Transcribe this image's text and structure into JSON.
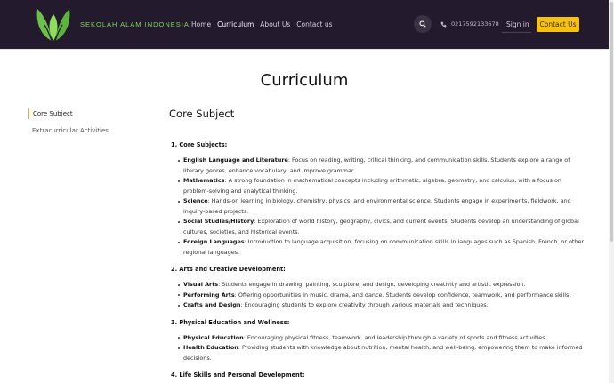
{
  "header": {
    "brand": "SEKOLAH ALAM INDONESIA",
    "nav": [
      {
        "label": "Home",
        "active": false
      },
      {
        "label": "Curriculum",
        "active": true
      },
      {
        "label": "About Us",
        "active": false
      },
      {
        "label": "Contact us",
        "active": false
      }
    ],
    "phone": "0217592133678",
    "signin": "Sign in",
    "contact_button": "Contact Us",
    "colors": {
      "background": "#241a2e",
      "accent": "#f5c211",
      "logo": "#7ed957"
    }
  },
  "page_title": "Curriculum",
  "sidebar": {
    "items": [
      {
        "label": "Core Subject",
        "active": true
      },
      {
        "label": "Extracurricular Activities",
        "active": false
      }
    ]
  },
  "main": {
    "section_title": "Core Subject",
    "groups": [
      {
        "heading": "1. Core Subjects:",
        "items": [
          {
            "term": "English Language and Literature",
            "text": ": Focus on reading, writing, critical thinking, and communication skills. Students explore a range of literary genres, enhance vocabulary, and improve grammar."
          },
          {
            "term": "Mathematics",
            "text": ": A strong foundation in mathematical concepts including arithmetic, algebra, geometry, and calculus, with a focus on problem-solving and analytical thinking."
          },
          {
            "term": "Science",
            "text": ": Hands-on learning in biology, chemistry, physics, and environmental science. Students engage in experiments, fieldwork, and inquiry-based projects."
          },
          {
            "term": "Social Studies/History",
            "text": ": Exploration of world history, geography, civics, and current events. Students develop an understanding of global cultures, societies, and historical events."
          },
          {
            "term": "Foreign Languages",
            "text": ": Introduction to language acquisition, focusing on communication skills in languages such as Spanish, French, or other regional languages."
          }
        ]
      },
      {
        "heading": "2. Arts and Creative Development:",
        "items": [
          {
            "term": "Visual Arts",
            "text": ": Students engage in drawing, painting, sculpture, and design, developing creativity and artistic expression."
          },
          {
            "term": "Performing Arts",
            "text": ": Offering opportunities in music, drama, and dance. Students develop confidence, teamwork, and performance skills."
          },
          {
            "term": "Crafts and Design",
            "text": ": Encouraging students to explore creativity through various materials and techniques."
          }
        ]
      },
      {
        "heading": "3. Physical Education and Wellness:",
        "items": [
          {
            "term": "Physical Education",
            "text": ": Encouraging physical fitness, teamwork, and leadership through a variety of sports and fitness activities."
          },
          {
            "term": "Health Education",
            "text": ": Providing students with knowledge about nutrition, mental health, and well-being, empowering them to make informed decisions."
          }
        ]
      },
      {
        "heading": "4. Life Skills and Personal Development:",
        "items": []
      }
    ]
  }
}
